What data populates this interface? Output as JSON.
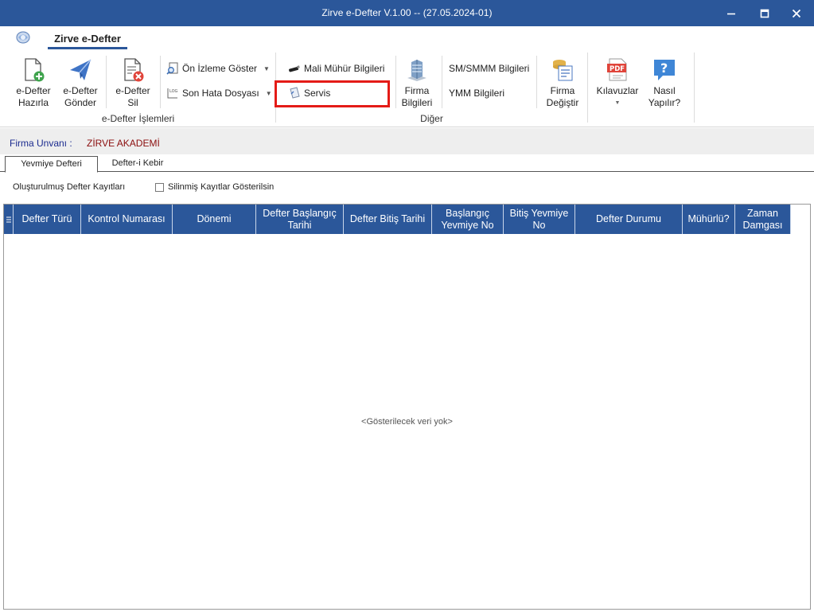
{
  "window": {
    "title": "Zirve e-Defter V.1.00  -- (27.05.2024-01)"
  },
  "ribbon_tab": "Zirve e-Defter",
  "edefter_group": {
    "label": "e-Defter İşlemleri",
    "hazirla": {
      "line1": "e-Defter",
      "line2": "Hazırla"
    },
    "gonder": {
      "line1": "e-Defter",
      "line2": "Gönder"
    },
    "sil": {
      "line1": "e-Defter",
      "line2": "Sil"
    },
    "on_izleme": "Ön İzleme Göster",
    "son_hata": "Son Hata Dosyası"
  },
  "diger_group": {
    "label": "Diğer",
    "mali_muhur": "Mali Mühür Bilgileri",
    "servis": "Servis",
    "firma_bilgileri": {
      "line1": "Firma",
      "line2": "Bilgileri"
    },
    "sm_smmm": "SM/SMMM Bilgileri",
    "ymm": "YMM Bilgileri",
    "firma_degistir": {
      "line1": "Firma",
      "line2": "Değiştir"
    }
  },
  "kilavuzlar": "Kılavuzlar",
  "nasil": {
    "line1": "Nasıl",
    "line2": "Yapılır?"
  },
  "firma": {
    "label": "Firma Unvanı :",
    "value": "ZİRVE AKADEMİ"
  },
  "doc_tabs": [
    "Yevmiye Defteri",
    "Defter-i Kebir"
  ],
  "records_label": "Oluşturulmuş Defter Kayıtları",
  "show_deleted_label": "Silinmiş Kayıtlar Gösterilsin",
  "columns": [
    {
      "label": "Defter Türü"
    },
    {
      "label": "Kontrol Numarası"
    },
    {
      "label": "Dönemi"
    },
    {
      "label": "Defter Başlangıç Tarihi"
    },
    {
      "label": "Defter Bitiş Tarihi"
    },
    {
      "label": "Başlangıç Yevmiye No"
    },
    {
      "label": "Bitiş Yevmiye No"
    },
    {
      "label": "Defter Durumu"
    },
    {
      "label": "Mühürlü?"
    },
    {
      "label": "Zaman Damgası"
    }
  ],
  "empty_message": "<Gösterilecek veri yok>"
}
